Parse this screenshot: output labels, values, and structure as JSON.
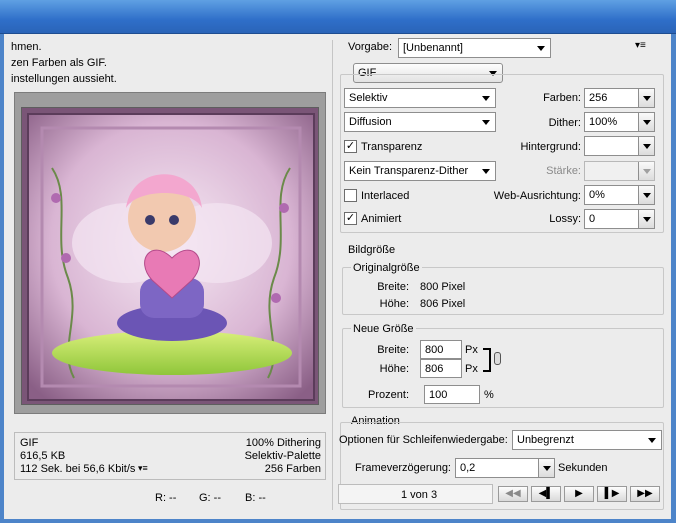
{
  "hints": [
    "hmen.",
    "zen Farben als GIF.",
    "instellungen aussieht."
  ],
  "preview": {
    "image_desc": "pink-haired fairy child holding a heart"
  },
  "info": {
    "format": "GIF",
    "size": "616,5 KB",
    "time": "112 Sek. bei 56,6 Kbit/s",
    "dither": "100% Dithering",
    "palette": "Selektiv-Palette",
    "colors": "256 Farben"
  },
  "readout": {
    "r": "R: --",
    "g": "G: --",
    "b": "B: --"
  },
  "vorgabe": {
    "label": "Vorgabe:",
    "value": "[Unbenannt]"
  },
  "format": "GIF",
  "settings": {
    "reduction": "Selektiv",
    "colors_label": "Farben:",
    "colors_value": "256",
    "dither_algo": "Diffusion",
    "dither_label": "Dither:",
    "dither_value": "100%",
    "transparency_label": "Transparenz",
    "transparency_checked": true,
    "background_label": "Hintergrund:",
    "background_value": "",
    "trans_dither": "Kein Transparenz-Dither",
    "amount_label": "Stärke:",
    "amount_value": "",
    "interlaced_label": "Interlaced",
    "interlaced_checked": false,
    "web_label": "Web-Ausrichtung:",
    "web_value": "0%",
    "animated_label": "Animiert",
    "animated_checked": true,
    "lossy_label": "Lossy:",
    "lossy_value": "0"
  },
  "image_size": {
    "title": "Bildgröße",
    "original_title": "Originalgröße",
    "width_label": "Breite:",
    "width_value": "800 Pixel",
    "height_label": "Höhe:",
    "height_value": "806 Pixel",
    "new_title": "Neue Größe",
    "new_width_label": "Breite:",
    "new_width_value": "800",
    "new_width_unit": "Px",
    "new_height_label": "Höhe:",
    "new_height_value": "806",
    "new_height_unit": "Px",
    "percent_label": "Prozent:",
    "percent_value": "100",
    "percent_unit": "%"
  },
  "animation": {
    "title": "Animation",
    "loop_label": "Optionen für Schleifenwiedergabe:",
    "loop_value": "Unbegrenzt",
    "delay_label": "Frameverzögerung:",
    "delay_value": "0,2",
    "delay_unit": "Sekunden",
    "frame_counter": "1 von 3"
  },
  "colors": {
    "titlebar": "#2f6fc9",
    "window_border": "#4d84c9"
  }
}
